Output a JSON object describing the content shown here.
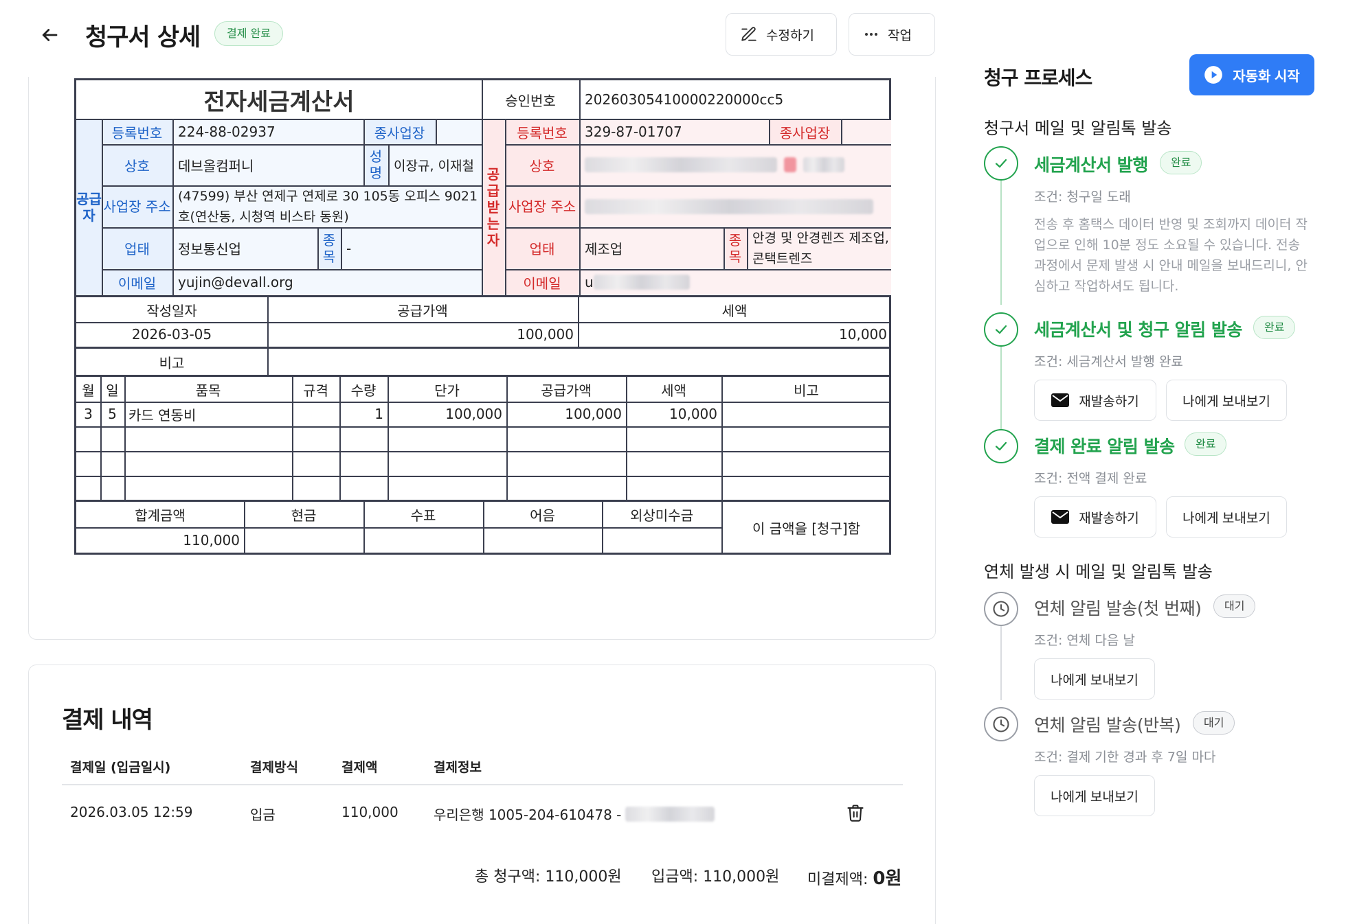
{
  "header": {
    "title": "청구서 상세",
    "status": "결제 완료",
    "edit_label": "수정하기",
    "work_label": "작업"
  },
  "invoice": {
    "title": "전자세금계산서",
    "approval_label": "승인번호",
    "approval_number": "20260305410000220000cc5",
    "supplier": {
      "side_label": "공급자",
      "reg_label": "등록번호",
      "reg_no": "224-88-02937",
      "branch_label": "종사업장",
      "name_label": "상호",
      "name": "데브올컴퍼니",
      "rep_label": "성명",
      "rep": "이장규, 이재철",
      "addr_label": "사업장 주소",
      "addr": "(47599) 부산 연제구 연제로 30 105동 오피스 9021호(연산동, 시청역 비스타 동원)",
      "biz_label": "업태",
      "biz": "정보통신업",
      "item_label": "종목",
      "item": "-",
      "email_label": "이메일",
      "email": "yujin@devall.org"
    },
    "buyer": {
      "side_label": "공급받는자",
      "reg_label": "등록번호",
      "reg_no": "329-87-01707",
      "branch_label": "종사업장",
      "name_label": "상호",
      "addr_label": "사업장 주소",
      "biz_label": "업태",
      "biz": "제조업",
      "item_label": "종목",
      "item": "안경 및 안경렌즈 제조업, 콘택트렌즈",
      "email_label": "이메일",
      "email_prefix": "u"
    },
    "summary": {
      "date_label": "작성일자",
      "supply_label": "공급가액",
      "tax_label": "세액",
      "date": "2026-03-05",
      "supply": "100,000",
      "tax": "10,000",
      "note_label": "비고"
    },
    "items_header": [
      "월",
      "일",
      "품목",
      "규격",
      "수량",
      "단가",
      "공급가액",
      "세액",
      "비고"
    ],
    "items": [
      {
        "month": "3",
        "day": "5",
        "name": "카드 연동비",
        "spec": "",
        "qty": "1",
        "unit": "100,000",
        "supply": "100,000",
        "tax": "10,000",
        "note": ""
      }
    ],
    "totals": {
      "total_label": "합계금액",
      "cash_label": "현금",
      "check_label": "수표",
      "note_label": "어음",
      "credit_label": "외상미수금",
      "total": "110,000",
      "claim_text": "이 금액을 [청구]함"
    }
  },
  "payment": {
    "title": "결제 내역",
    "columns": [
      "결제일 (입금일시)",
      "결제방식",
      "결제액",
      "결제정보"
    ],
    "row": {
      "date": "2026.03.05 12:59",
      "method": "입금",
      "amount": "110,000",
      "info": "우리은행 1005-204-610478 -"
    },
    "total_label": "총 청구액:",
    "total": "110,000원",
    "paid_label": "입금액:",
    "paid": "110,000원",
    "unpaid_label": "미결제액:",
    "unpaid": "0원"
  },
  "process": {
    "title": "청구 프로세스",
    "auto_label": "자동화 시작",
    "section1": "청구서 메일 및 알림톡 발송",
    "section2": "연체 발생 시 메일 및 알림톡 발송",
    "steps": [
      {
        "title": "세금계산서 발행",
        "badge": "완료",
        "cond": "조건: 청구일 도래",
        "desc": "전송 후 홈택스 데이터 반영 및 조회까지 데이터 작업으로 인해 10분 정도 소요될 수 있습니다. 전송 과정에서 문제 발생 시 안내 메일을 보내드리니, 안심하고 작업하셔도 됩니다."
      },
      {
        "title": "세금계산서 및 청구 알림 발송",
        "badge": "완료",
        "cond": "조건: 세금계산서 발행 완료",
        "resend": "재발송하기",
        "preview": "나에게 보내보기"
      },
      {
        "title": "결제 완료 알림 발송",
        "badge": "완료",
        "cond": "조건: 전액 결제 완료",
        "resend": "재발송하기",
        "preview": "나에게 보내보기"
      },
      {
        "title": "연체 알림 발송(첫 번째)",
        "badge": "대기",
        "cond": "조건: 연체 다음 날",
        "preview": "나에게 보내보기"
      },
      {
        "title": "연체 알림 발송(반복)",
        "badge": "대기",
        "cond": "조건: 결제 기한 경과 후 7일 마다",
        "preview": "나에게 보내보기"
      }
    ]
  }
}
